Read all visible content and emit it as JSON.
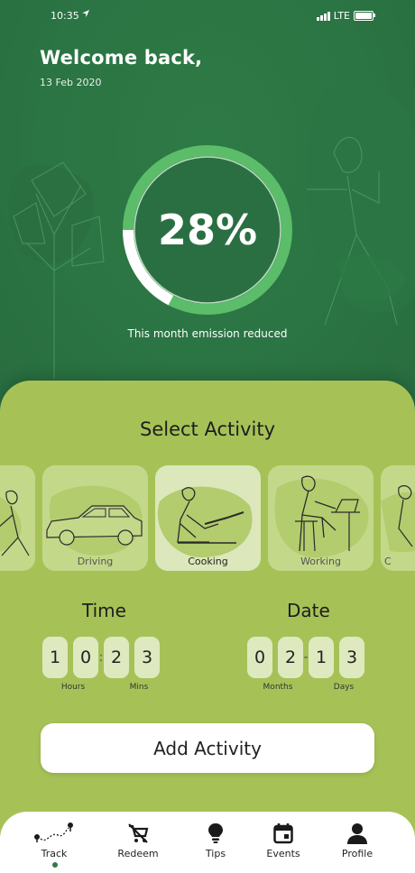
{
  "status_bar": {
    "time": "10:35",
    "network": "LTE"
  },
  "header": {
    "greeting": "Welcome back,",
    "date": "13 Feb 2020"
  },
  "progress": {
    "percent_text": "28%",
    "value": 0.28,
    "caption": "This month emission reduced"
  },
  "colors": {
    "dark_green": "#2f7a45",
    "light_green": "#a6c257",
    "ring": "#5bbd6a"
  },
  "activity_section": {
    "title": "Select Activity",
    "items": [
      {
        "label": "g",
        "icon": "walking-icon",
        "active": false
      },
      {
        "label": "Driving",
        "icon": "car-icon",
        "active": false
      },
      {
        "label": "Cooking",
        "icon": "cooking-icon",
        "active": true
      },
      {
        "label": "Working",
        "icon": "laptop-desk-icon",
        "active": false
      },
      {
        "label": "C",
        "icon": "partial-icon",
        "active": false
      }
    ]
  },
  "time": {
    "title": "Time",
    "digits": [
      "1",
      "0",
      "2",
      "3"
    ],
    "separator": ":",
    "units": [
      "Hours",
      "Mins"
    ]
  },
  "date_picker": {
    "title": "Date",
    "digits": [
      "0",
      "2",
      "1",
      "3"
    ],
    "separator": "-",
    "units": [
      "Months",
      "Days"
    ]
  },
  "add_button": {
    "label": "Add Activity"
  },
  "bottom_nav": {
    "items": [
      {
        "label": "Track",
        "icon": "route-icon",
        "active": true
      },
      {
        "label": "Redeem",
        "icon": "cart-off-icon",
        "active": false
      },
      {
        "label": "Tips",
        "icon": "lightbulb-icon",
        "active": false
      },
      {
        "label": "Events",
        "icon": "calendar-icon",
        "active": false
      },
      {
        "label": "Profile",
        "icon": "person-icon",
        "active": false
      }
    ]
  }
}
